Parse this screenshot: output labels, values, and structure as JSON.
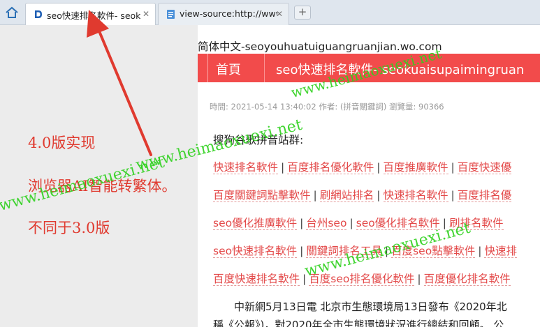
{
  "browser": {
    "home_icon": "home-icon",
    "tabs": [
      {
        "title": "seo快速排名軟件- seok",
        "favicon": "site-d-logo",
        "close": "✕"
      },
      {
        "title": "view-source:http://www",
        "favicon": "document-icon",
        "close": "✕"
      }
    ],
    "new_tab": "+"
  },
  "page": {
    "lang_line": "简体中文-seoyouhuatuiguangruanjian.wo.com",
    "nav": {
      "home": "首頁",
      "site_title": "seo快速排名軟件- seokuaisupaimingruan"
    },
    "meta": "時間: 2021-05-14 13:40:02 作者: (拼音關鍵詞) 瀏覽量: 90366",
    "subhead": "搜狗谷歌拼音站群:",
    "link_rows": [
      [
        "快速排名軟件",
        "百度排名優化軟件",
        "百度推廣軟件",
        "百度快速優"
      ],
      [
        "百度關鍵詞點擊軟件",
        "刷網站排名",
        "快速排名軟件",
        "百度排名優"
      ],
      [
        "seo優化推廣軟件",
        "台州seo",
        "seo優化排名軟件",
        "刷排名軟件"
      ],
      [
        "seo快速排名軟件",
        "關鍵詞排名工具",
        "百度seo點擊軟件",
        "快速排"
      ],
      [
        "百度快速排名軟件",
        "百度seo排名優化軟件",
        "百度優化排名軟件"
      ]
    ],
    "paragraph": [
      "　　中新網5月13日電 北京市生態環境局13日發布《2020年北",
      "稱《公報》)，對2020年全市生態環境狀況進行總結和回顧。 公"
    ]
  },
  "annotations": {
    "notes": [
      "4.0版实现",
      "浏览器AI智能转繁体。",
      "不同于3.0版"
    ],
    "watermarks": [
      "www.heimaoxuexi.net",
      "www.heimaoxuexi.net",
      "www.heimaoxuexi.net",
      "www.heimaoxuexi.net"
    ],
    "arrow_color": "#e03a2f",
    "watermark_color": "#2fd11e"
  },
  "colors": {
    "accent": "#f24b4b",
    "link": "#e34848"
  }
}
